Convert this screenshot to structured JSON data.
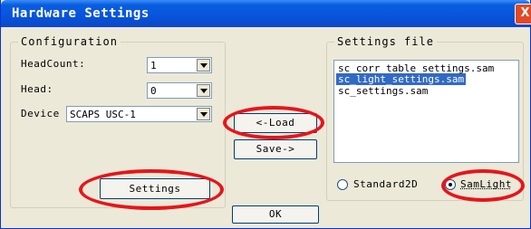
{
  "window": {
    "title": "Hardware Settings",
    "close_glyph": "X"
  },
  "configuration": {
    "legend": "Configuration",
    "headcount_label": "HeadCount:",
    "headcount_value": "1",
    "head_label": "Head:",
    "head_value": "0",
    "device_label": "Device",
    "device_value": "SCAPS USC-1"
  },
  "buttons": {
    "settings": "Settings",
    "load": "<-Load",
    "save": "Save->",
    "ok": "OK"
  },
  "settings_file": {
    "legend": "Settings file",
    "items": [
      {
        "label": "sc_corr_table_settings.sam",
        "selected": false
      },
      {
        "label": "sc_light_settings.sam",
        "selected": true
      },
      {
        "label": "sc_settings.sam",
        "selected": false
      }
    ],
    "radio_standard2d": "Standard2D",
    "radio_samlight": "SamLight",
    "selected_mode": "SamLight"
  },
  "annotations": {
    "highlight_color": "#e8141b"
  }
}
